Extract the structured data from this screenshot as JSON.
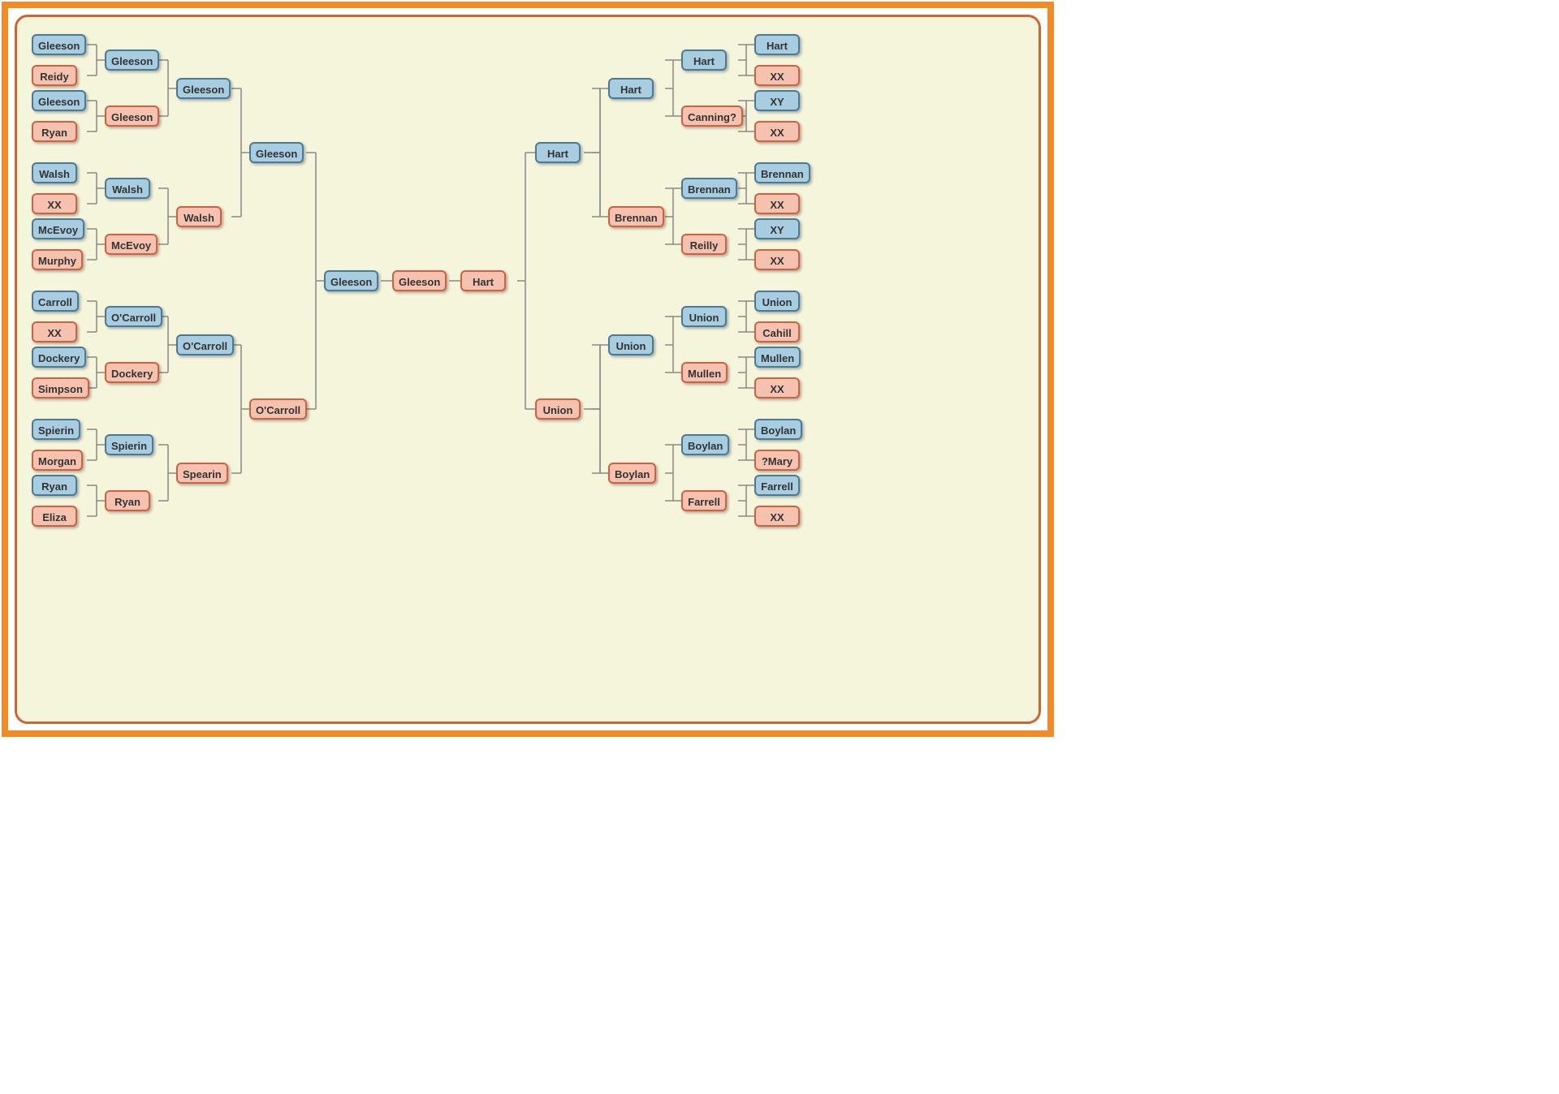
{
  "left": {
    "g5": [
      {
        "m": "Gleeson",
        "f": "Reidy"
      },
      {
        "m": "Gleeson",
        "f": "Ryan"
      },
      {
        "m": "Walsh",
        "f": "XX"
      },
      {
        "m": "McEvoy",
        "f": "Murphy"
      },
      {
        "m": "Carroll",
        "f": "XX"
      },
      {
        "m": "Dockery",
        "f": "Simpson"
      },
      {
        "m": "Spierin",
        "f": "Morgan"
      },
      {
        "m": "Ryan",
        "f": "Eliza"
      }
    ],
    "g4": [
      {
        "m": "Gleeson",
        "f": "Gleeson"
      },
      {
        "m": "Walsh",
        "f": "McEvoy"
      },
      {
        "m": "O'Carroll",
        "f": "Dockery"
      },
      {
        "m": "Spierin",
        "f": "Ryan"
      }
    ],
    "g3": [
      {
        "m": "Gleeson",
        "f": "Walsh"
      },
      {
        "m": "O'Carroll",
        "f": "Spearin"
      }
    ],
    "g2": {
      "m": "Gleeson",
      "f": "O'Carroll"
    },
    "g1m": "Gleeson"
  },
  "center": {
    "f": "Gleeson"
  },
  "right": {
    "g1f": "Hart",
    "g2": {
      "m": "Hart",
      "f": "Union"
    },
    "g3": [
      {
        "m": "Hart",
        "f": "Brennan"
      },
      {
        "m": "Union",
        "f": "Boylan"
      }
    ],
    "g4": [
      {
        "m": "Hart",
        "f": "Canning?"
      },
      {
        "m": "Brennan",
        "f": "Reilly"
      },
      {
        "m": "Union",
        "f": "Mullen"
      },
      {
        "m": "Boylan",
        "f": "Farrell"
      }
    ],
    "g5": [
      {
        "m": "Hart",
        "f": "XX"
      },
      {
        "m": "XY",
        "f": "XX"
      },
      {
        "m": "Brennan",
        "f": "XX"
      },
      {
        "m": "XY",
        "f": "XX"
      },
      {
        "m": "Union",
        "f": "Cahill"
      },
      {
        "m": "Mullen",
        "f": "XX"
      },
      {
        "m": "Boylan",
        "f": "?Mary"
      },
      {
        "m": "Farrell",
        "f": "XX"
      }
    ]
  }
}
